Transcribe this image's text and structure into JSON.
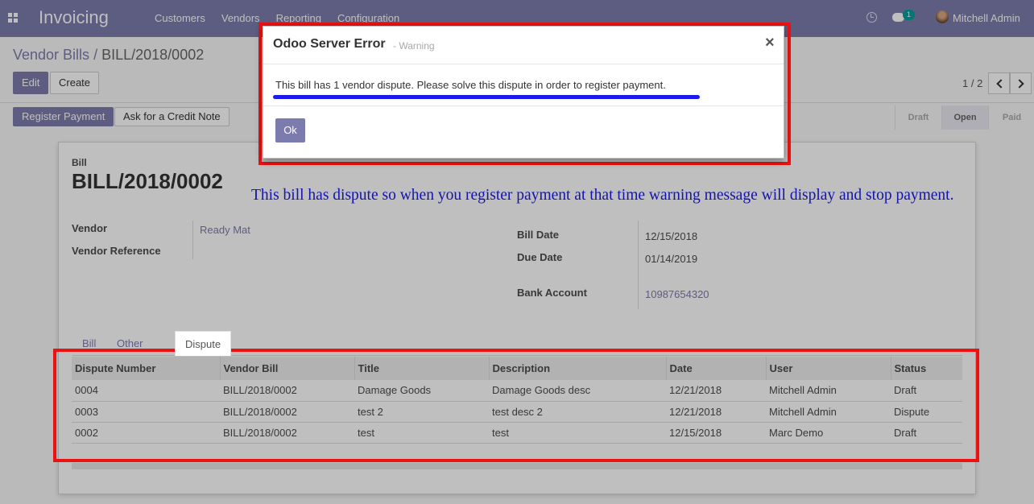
{
  "navbar": {
    "brand": "Invoicing",
    "menu": [
      "Customers",
      "Vendors",
      "Reporting",
      "Configuration"
    ],
    "chat_count": "1",
    "user": "Mitchell Admin"
  },
  "breadcrumb": {
    "parent": "Vendor Bills",
    "separator": "/",
    "current": "BILL/2018/0002"
  },
  "toolbar": {
    "edit": "Edit",
    "create": "Create",
    "pager": "1 / 2"
  },
  "actions": {
    "register_payment": "Register Payment",
    "credit_note": "Ask for a Credit Note"
  },
  "stages": [
    {
      "label": "Draft",
      "active": false
    },
    {
      "label": "Open",
      "active": true
    },
    {
      "label": "Paid",
      "active": false
    }
  ],
  "form": {
    "doc_type": "Bill",
    "number": "BILL/2018/0002",
    "vendor_label": "Vendor",
    "vendor_value": "Ready Mat",
    "vendor_ref_label": "Vendor Reference",
    "bill_date_label": "Bill Date",
    "bill_date": "12/15/2018",
    "due_date_label": "Due Date",
    "due_date": "01/14/2019",
    "bank_label": "Bank Account",
    "bank_value": "10987654320"
  },
  "annotation": "This bill has dispute so when you register payment at that time warning message will display and stop payment.",
  "tabs": [
    "Bill",
    "Other Info",
    "Dispute"
  ],
  "dispute_table": {
    "columns": [
      "Dispute Number",
      "Vendor Bill",
      "Title",
      "Description",
      "Date",
      "User",
      "Status"
    ],
    "rows": [
      [
        "0004",
        "BILL/2018/0002",
        "Damage Goods",
        "Damage Goods desc",
        "12/21/2018",
        "Mitchell Admin",
        "Draft"
      ],
      [
        "0003",
        "BILL/2018/0002",
        "test 2",
        "test desc 2",
        "12/21/2018",
        "Mitchell Admin",
        "Dispute"
      ],
      [
        "0002",
        "BILL/2018/0002",
        "test",
        "test",
        "12/15/2018",
        "Marc Demo",
        "Draft"
      ]
    ]
  },
  "modal": {
    "title": "Odoo Server Error",
    "subtitle": "- Warning",
    "close_glyph": "×",
    "message": "This bill has 1 vendor dispute. Please solve this dispute in order to register payment.",
    "ok": "Ok"
  },
  "colors": {
    "brand": "#7c7bad",
    "highlight_red": "#ee1111",
    "annotation_blue": "#1a1ae8"
  }
}
